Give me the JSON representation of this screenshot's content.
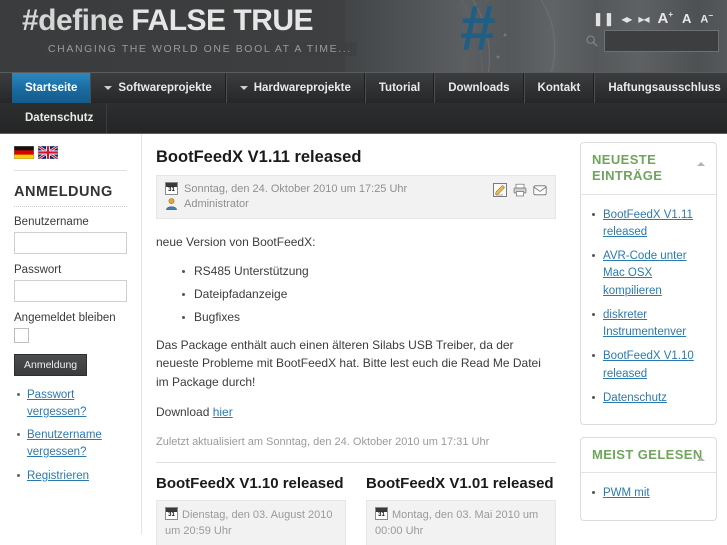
{
  "header": {
    "title_hash": "#define",
    "title_rest": " FALSE TRUE",
    "tagline": "CHANGING THE WORLD ONE BOOL AT A TIME...",
    "hash_logo": "#",
    "controls": {
      "pause": "❚❚",
      "expand": "◂▸",
      "collapse": "▸◂",
      "font_increase": "A",
      "font_increase_sup": "+",
      "font_normal": "A",
      "font_decrease": "A",
      "font_decrease_sup": "−"
    },
    "search": {
      "icon": "search-icon",
      "value": "",
      "placeholder": ""
    }
  },
  "nav": {
    "items": [
      {
        "label": "Startseite",
        "active": true,
        "caret": false
      },
      {
        "label": "Softwareprojekte",
        "active": false,
        "caret": true
      },
      {
        "label": "Hardwareprojekte",
        "active": false,
        "caret": true
      },
      {
        "label": "Tutorial",
        "active": false,
        "caret": false
      },
      {
        "label": "Downloads",
        "active": false,
        "caret": false
      },
      {
        "label": "Kontakt",
        "active": false,
        "caret": false
      },
      {
        "label": "Haftungsausschluss",
        "active": false,
        "caret": false
      }
    ],
    "subitems": [
      {
        "label": "Datenschutz"
      }
    ]
  },
  "sidebar_left": {
    "flags": [
      "flag-de",
      "flag-gb"
    ],
    "login": {
      "title": "ANMELDUNG",
      "username_label": "Benutzername",
      "username_value": "",
      "password_label": "Passwort",
      "password_value": "",
      "remember_label": "Angemeldet bleiben",
      "remember_checked": false,
      "submit_label": "Anmeldung"
    },
    "links": [
      "Passwort vergessen?",
      "Benutzername vergessen?",
      "Registrieren"
    ]
  },
  "main": {
    "article": {
      "title": "BootFeedX V1.11 released",
      "date": "Sonntag, den 24. Oktober 2010 um 17:25 Uhr",
      "author": "Administrator",
      "icons": [
        "edit-icon",
        "print-icon",
        "email-icon"
      ],
      "intro": "neue Version von BootFeedX:",
      "bullets": [
        "RS485 Unterstützung",
        "Dateipfadanzeige",
        "Bugfixes"
      ],
      "body": "Das Package enthält auch einen älteren Silabs USB Treiber, da der neueste Probleme mit BootFeedX hat. Bitte lest euch die Read Me Datei im Package durch!",
      "download_prefix": "Download ",
      "download_link": "hier",
      "updated": "Zuletzt aktualisiert am Sonntag, den 24. Oktober 2010 um 17:31 Uhr"
    },
    "sub_articles": [
      {
        "title": "BootFeedX V1.10 released",
        "date": "Dienstag, den 03. August 2010 um 20:59 Uhr"
      },
      {
        "title": "BootFeedX V1.01 released",
        "date": "Montag, den 03. Mai 2010 um 00:00 Uhr"
      }
    ]
  },
  "sidebar_right": {
    "modules": [
      {
        "title": "NEUESTE EINTRÄGE",
        "items": [
          "BootFeedX V1.11 released",
          "AVR-Code unter Mac OSX kompilieren",
          "diskreter Instrumentenver",
          "BootFeedX V1.10 released",
          "Datenschutz"
        ]
      },
      {
        "title": "MEIST GELESEN",
        "items": [
          "PWM mit"
        ]
      }
    ]
  },
  "colors": {
    "accent_blue": "#1a6a9e",
    "link_blue": "#2a7ab0",
    "module_green": "#6fa55d",
    "header_dark": "#3a3c3d",
    "logo_hash": "#1f5f86"
  }
}
